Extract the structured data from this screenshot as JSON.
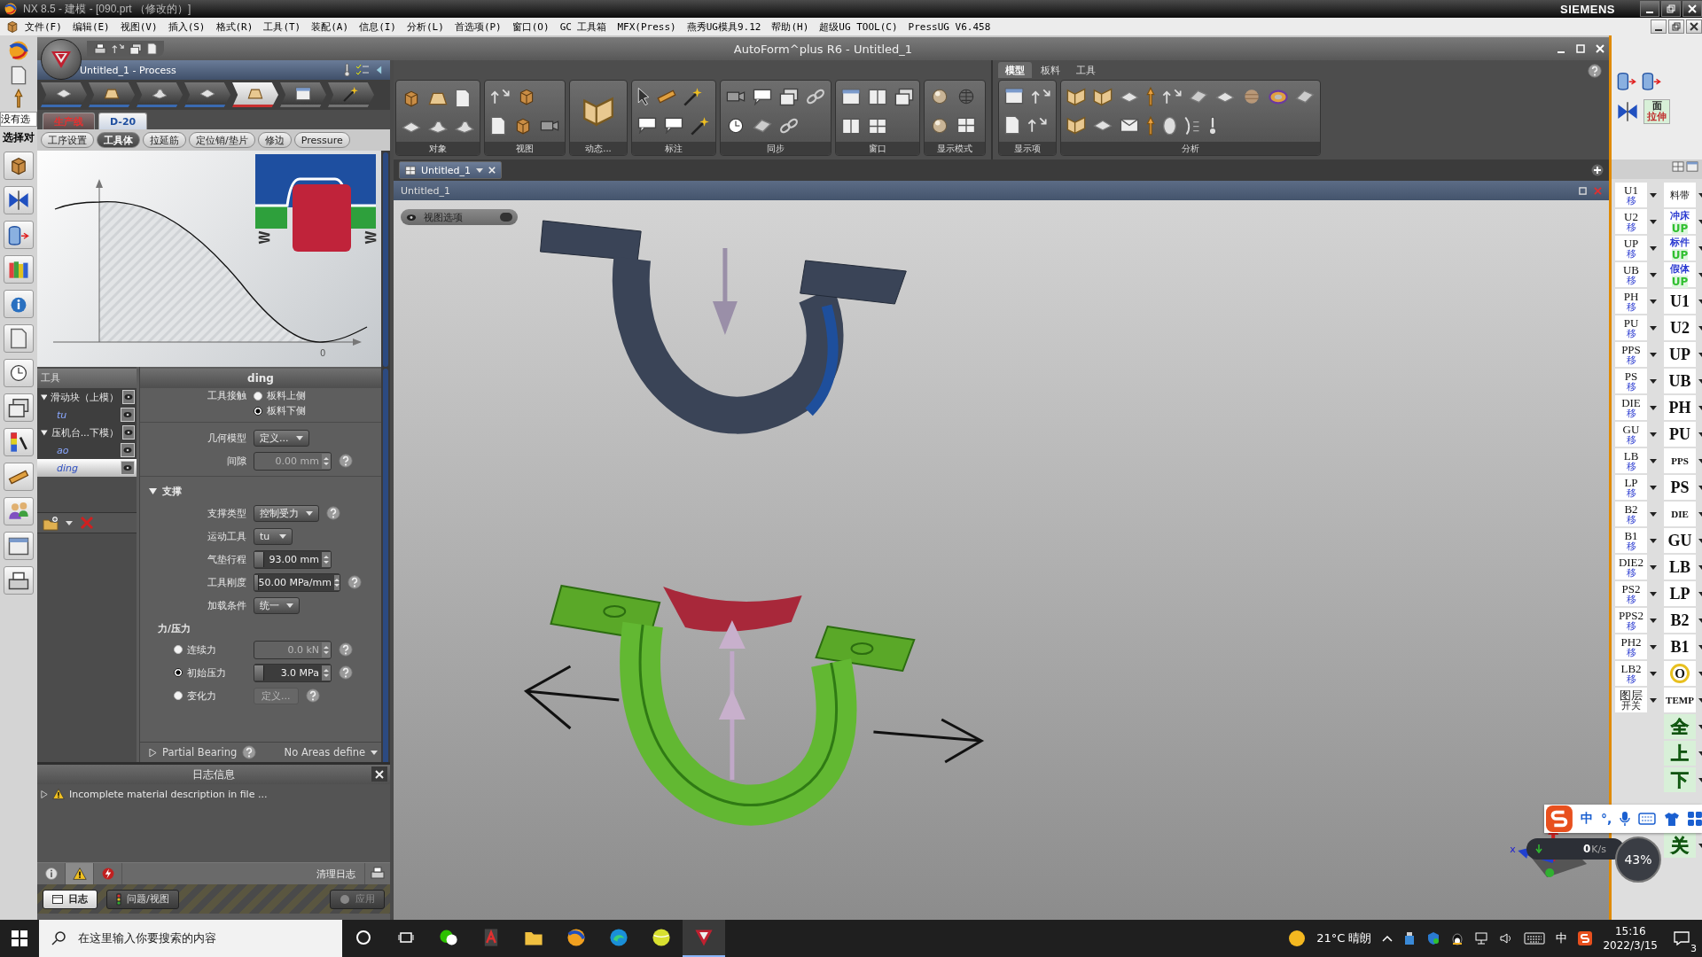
{
  "nx_window": {
    "title": "NX 8.5 - 建模 - [090.prt （修改的）]",
    "brand": "SIEMENS"
  },
  "nx_menu": [
    "文件(F)",
    "编辑(E)",
    "视图(V)",
    "插入(S)",
    "格式(R)",
    "工具(T)",
    "装配(A)",
    "信息(I)",
    "分析(L)",
    "首选项(P)",
    "窗口(O)",
    "GC 工具箱",
    "MFX(Press)",
    "燕秀UG模具9.12",
    "帮助(H)",
    "超级UG TOOL(C)",
    "PressUG V6.458"
  ],
  "nx_left": {
    "filter_value": "没有选",
    "select_label": "选择对"
  },
  "autoform": {
    "title": "AutoForm^plus R6 - Untitled_1",
    "panel": {
      "title": "Untitled_1 - Process",
      "process_steps": [
        {
          "done": true,
          "selected": false
        },
        {
          "done": true,
          "selected": false
        },
        {
          "done": true,
          "selected": false
        },
        {
          "done": true,
          "selected": false
        },
        {
          "done": false,
          "selected": true
        },
        {
          "done": false,
          "selected": false
        },
        {
          "done": false,
          "selected": false
        }
      ],
      "line_tabs": [
        {
          "label": "生产线",
          "selected": false
        },
        {
          "label": "D-20",
          "selected": true
        }
      ],
      "sub_tabs": [
        {
          "label": "工序设置",
          "selected": false
        },
        {
          "label": "工具体",
          "selected": true
        },
        {
          "label": "拉延筋",
          "selected": false
        },
        {
          "label": "定位销/垫片",
          "selected": false
        },
        {
          "label": "修边",
          "selected": false
        },
        {
          "label": "Pressure",
          "selected": false
        }
      ],
      "preview": {
        "x_tick": "0"
      },
      "tools": {
        "heading": "工具",
        "items": [
          {
            "label": "滑动块（上模）",
            "expanded": true,
            "selected": false,
            "children": [
              {
                "label": "tu",
                "selected": false
              }
            ]
          },
          {
            "label": "压机台...下模）",
            "expanded": true,
            "selected": false,
            "children": [
              {
                "label": "ao",
                "selected": false
              },
              {
                "label": "ding",
                "selected": true
              }
            ]
          }
        ]
      },
      "properties": {
        "title": "ding",
        "contact": {
          "label": "工具接触",
          "options": [
            {
              "label": "板料上侧",
              "selected": false
            },
            {
              "label": "板料下侧",
              "selected": true
            }
          ]
        },
        "fields": [
          {
            "kind": "dropdown",
            "label": "几何模型",
            "value": "定义..."
          },
          {
            "kind": "number",
            "label": "间隙",
            "value": "0.00 mm",
            "disabled": true,
            "help": true
          }
        ],
        "support": {
          "label": "支撑",
          "expanded": true,
          "fields": [
            {
              "kind": "dropdown",
              "label": "支撑类型",
              "value": "控制受力",
              "help": true
            },
            {
              "kind": "dropdown",
              "label": "运动工具",
              "value": "tu"
            },
            {
              "kind": "number",
              "label": "气垫行程",
              "value": "93.00 mm",
              "variation": true
            },
            {
              "kind": "number",
              "label": "工具刚度",
              "value": "50.00 MPa/mm",
              "variation": true,
              "help": true
            },
            {
              "kind": "dropdown",
              "label": "加载条件",
              "value": "统一"
            }
          ]
        },
        "force": {
          "label": "力/压力",
          "options": [
            {
              "label": "连续力",
              "kind": "number",
              "value": "0.0 kN",
              "selected": false,
              "disabled": true,
              "help": true
            },
            {
              "label": "初始压力",
              "kind": "number",
              "value": "3.0 MPa",
              "selected": true,
              "variation": true,
              "help": true
            },
            {
              "label": "变化力",
              "kind": "button",
              "value": "定义...",
              "selected": false,
              "disabled": true,
              "help": true
            }
          ]
        },
        "partial_bearing": {
          "label": "Partial Bearing",
          "status": "No Areas define",
          "expanded": false
        }
      },
      "log": {
        "title": "日志信息",
        "entries": [
          {
            "kind": "warning",
            "text": "Incomplete material description in file ..."
          }
        ],
        "filters": [
          {
            "kind": "info",
            "selected": false
          },
          {
            "kind": "warning",
            "selected": true
          },
          {
            "kind": "error",
            "selected": false
          }
        ],
        "clear_button": "清理日志"
      },
      "bottom_tabs": [
        {
          "label": "日志",
          "selected": true
        },
        {
          "label": "问题/视图",
          "selected": false
        }
      ],
      "apply_button": {
        "label": "应用",
        "disabled": true
      }
    },
    "ribbon": {
      "groups": [
        {
          "label": "对象"
        },
        {
          "label": "视图"
        },
        {
          "label": "动态..."
        },
        {
          "label": "标注"
        },
        {
          "label": "同步"
        },
        {
          "label": "窗口"
        },
        {
          "label": "显示模式"
        }
      ],
      "tabs": [
        {
          "label": "模型",
          "selected": true
        },
        {
          "label": "板料",
          "selected": false
        },
        {
          "label": "工具",
          "selected": false
        }
      ],
      "tab_groups": [
        {
          "label": "显示项"
        },
        {
          "label": "分析"
        }
      ]
    },
    "document_tabs": [
      {
        "label": "Untitled_1",
        "selected": true
      }
    ],
    "viewport": {
      "title": "Untitled_1",
      "view_options": "视图选项",
      "axis_label": "x"
    }
  },
  "nx_right": {
    "face_button": {
      "top": "面",
      "bottom": "拉伸"
    },
    "column_1": [
      {
        "text": "U1",
        "sub": "移"
      },
      {
        "text": "U2",
        "sub": "移"
      },
      {
        "text": "UP",
        "sub": "移"
      },
      {
        "text": "UB",
        "sub": "移"
      },
      {
        "text": "PH",
        "sub": "移"
      },
      {
        "text": "PU",
        "sub": "移"
      },
      {
        "text": "PPS",
        "sub": "移"
      },
      {
        "text": "PS",
        "sub": "移"
      },
      {
        "text": "DIE",
        "sub": "移"
      },
      {
        "text": "GU",
        "sub": "移"
      },
      {
        "text": "LB",
        "sub": "移"
      },
      {
        "text": "LP",
        "sub": "移"
      },
      {
        "text": "B2",
        "sub": "移"
      },
      {
        "text": "B1",
        "sub": "移"
      },
      {
        "text": "DIE2",
        "sub": "移"
      },
      {
        "text": "PS2",
        "sub": "移"
      },
      {
        "text": "PPS2",
        "sub": "移"
      },
      {
        "text": "PH2",
        "sub": "移"
      },
      {
        "text": "LB2",
        "sub": "移"
      },
      {
        "text": "图层",
        "sub": "开关"
      }
    ],
    "column_2": [
      {
        "kind": "plain",
        "text": "料带"
      },
      {
        "kind": "stack",
        "text": "冲床",
        "sub": "UP"
      },
      {
        "kind": "stack",
        "text": "标件",
        "sub": "UP"
      },
      {
        "kind": "stack",
        "text": "假体",
        "sub": "UP"
      },
      {
        "kind": "bold",
        "text": "U1"
      },
      {
        "kind": "bold",
        "text": "U2"
      },
      {
        "kind": "bold",
        "text": "UP"
      },
      {
        "kind": "bold",
        "text": "UB"
      },
      {
        "kind": "bold",
        "text": "PH"
      },
      {
        "kind": "bold",
        "text": "PU"
      },
      {
        "kind": "small",
        "text": "PPS"
      },
      {
        "kind": "bold",
        "text": "PS"
      },
      {
        "kind": "small",
        "text": "DIE"
      },
      {
        "kind": "bold",
        "text": "GU"
      },
      {
        "kind": "bold",
        "text": "LB"
      },
      {
        "kind": "bold",
        "text": "LP"
      },
      {
        "kind": "bold",
        "text": "B2"
      },
      {
        "kind": "bold",
        "text": "B1"
      },
      {
        "kind": "ring",
        "text": "O"
      },
      {
        "kind": "small",
        "text": "TEMP"
      },
      {
        "kind": "green",
        "text": "全"
      },
      {
        "kind": "green",
        "text": "上"
      },
      {
        "kind": "green",
        "text": "下"
      },
      {
        "kind": "green",
        "text": "关"
      }
    ]
  },
  "ime_bar": {
    "mode": "中",
    "punctuation": "°,"
  },
  "net_meter": {
    "speed": "0",
    "unit": "K/s",
    "percent": "43%"
  },
  "taskbar": {
    "search_placeholder": "在这里输入你要搜索的内容",
    "apps": [
      {
        "kind": "chat",
        "active": false
      },
      {
        "kind": "document",
        "active": false
      },
      {
        "kind": "folder",
        "active": false
      },
      {
        "kind": "logo",
        "active": false
      },
      {
        "kind": "swirl",
        "active": false
      },
      {
        "kind": "ball",
        "active": false
      },
      {
        "kind": "triangle",
        "active": true
      }
    ],
    "weather": "21°C 晴朗",
    "ime": "中",
    "time": "15:16",
    "date": "2022/3/15",
    "notifications": "3"
  }
}
